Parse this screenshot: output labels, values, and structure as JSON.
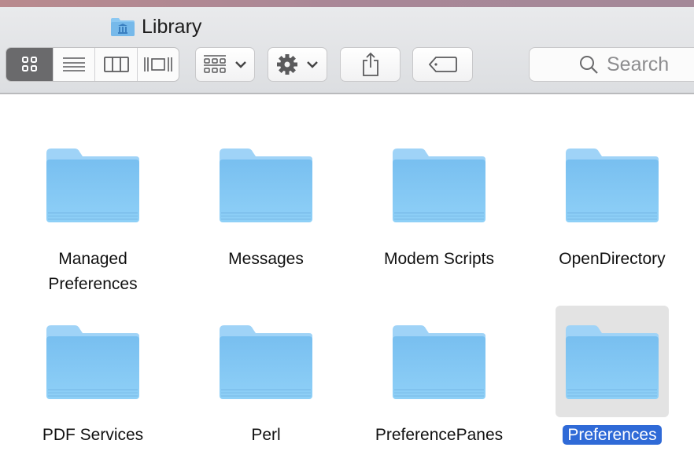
{
  "window": {
    "title": "Library",
    "title_icon": "library-folder-icon"
  },
  "toolbar": {
    "view_modes": [
      {
        "name": "icon-view",
        "icon": "grid-icon",
        "active": true
      },
      {
        "name": "list-view",
        "icon": "list-icon",
        "active": false
      },
      {
        "name": "column-view",
        "icon": "columns-icon",
        "active": false
      },
      {
        "name": "cover-flow-view",
        "icon": "coverflow-icon",
        "active": false
      }
    ],
    "arrange_icon": "arrange-grid-icon",
    "action_icon": "gear-icon",
    "share_icon": "share-icon",
    "tag_icon": "tag-icon",
    "search_placeholder": "Search"
  },
  "items": [
    {
      "label": "Managed Preferences",
      "selected": false
    },
    {
      "label": "Messages",
      "selected": false
    },
    {
      "label": "Modem Scripts",
      "selected": false
    },
    {
      "label": "OpenDirectory",
      "selected": false
    },
    {
      "label": "PDF Services",
      "selected": false
    },
    {
      "label": "Perl",
      "selected": false
    },
    {
      "label": "PreferencePanes",
      "selected": false
    },
    {
      "label": "Preferences",
      "selected": true
    }
  ],
  "colors": {
    "selection": "#2f6ad7",
    "folder": "#7cc3f2"
  }
}
